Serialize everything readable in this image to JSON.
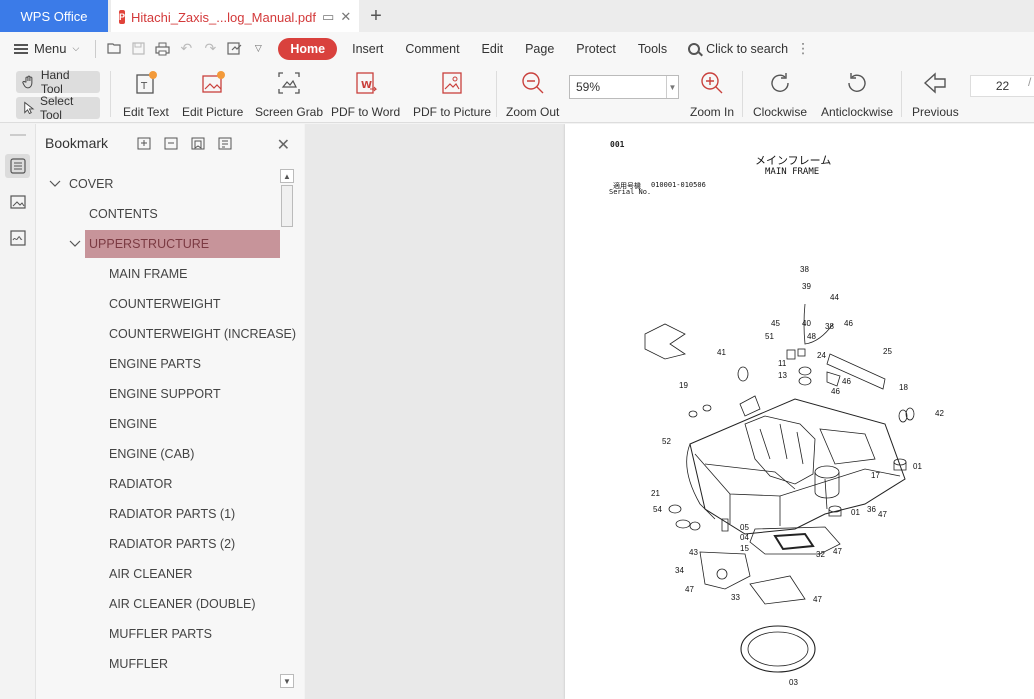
{
  "titlebar": {
    "app_tab": "WPS Office",
    "doc_tab": "Hitachi_Zaxis_...log_Manual.pdf",
    "new_tab": "+"
  },
  "menubar": {
    "menu_label": "Menu",
    "items": [
      "Home",
      "Insert",
      "Comment",
      "Edit",
      "Page",
      "Protect",
      "Tools"
    ],
    "active": "Home",
    "search_label": "Click to search"
  },
  "toolbar": {
    "hand_tool": "Hand Tool",
    "select_tool": "Select Tool",
    "edit_text": "Edit Text",
    "edit_picture": "Edit Picture",
    "screen_grab": "Screen Grab",
    "pdf_to_word": "PDF to Word",
    "pdf_to_picture": "PDF to Picture",
    "zoom_out": "Zoom Out",
    "zoom_value": "59%",
    "zoom_in": "Zoom In",
    "clockwise": "Clockwise",
    "anticlockwise": "Anticlockwise",
    "previous": "Previous",
    "page_number": "22",
    "page_total_fragment": "/"
  },
  "bookmark": {
    "title": "Bookmark",
    "items": [
      {
        "label": "COVER",
        "level": 0,
        "expanded": true
      },
      {
        "label": "CONTENTS",
        "level": 1
      },
      {
        "label": "UPPERSTRUCTURE",
        "level": 1,
        "expanded": true,
        "selected": true
      },
      {
        "label": "MAIN FRAME",
        "level": 2
      },
      {
        "label": "COUNTERWEIGHT",
        "level": 2
      },
      {
        "label": "COUNTERWEIGHT (INCREASE)",
        "level": 2
      },
      {
        "label": "ENGINE PARTS",
        "level": 2
      },
      {
        "label": "ENGINE SUPPORT",
        "level": 2
      },
      {
        "label": "ENGINE",
        "level": 2
      },
      {
        "label": "ENGINE (CAB)",
        "level": 2
      },
      {
        "label": "RADIATOR",
        "level": 2
      },
      {
        "label": "RADIATOR PARTS (1)",
        "level": 2
      },
      {
        "label": "RADIATOR PARTS (2)",
        "level": 2
      },
      {
        "label": "AIR CLEANER",
        "level": 2
      },
      {
        "label": "AIR CLEANER (DOUBLE)",
        "level": 2
      },
      {
        "label": "MUFFLER PARTS",
        "level": 2
      },
      {
        "label": "MUFFLER",
        "level": 2
      }
    ]
  },
  "document": {
    "page_code": "001",
    "title_jp": "メインフレーム",
    "title_en": "MAIN FRAME",
    "serial_jp": "適用号機",
    "serial_value": "010001-010506",
    "serial_en": "Serial No.",
    "callouts": [
      "38",
      "39",
      "44",
      "45",
      "40",
      "38",
      "46",
      "51",
      "48",
      "25",
      "41",
      "24",
      "11",
      "13",
      "46",
      "46",
      "19",
      "18",
      "42",
      "52",
      "01",
      "17",
      "21",
      "54",
      "05",
      "04",
      "15",
      "43",
      "36",
      "47",
      "01",
      "32",
      "47",
      "34",
      "47",
      "33",
      "47",
      "03"
    ]
  },
  "colors": {
    "wps_blue": "#3b7be8",
    "accent_red": "#d9413d",
    "selection": "#c7949a"
  }
}
